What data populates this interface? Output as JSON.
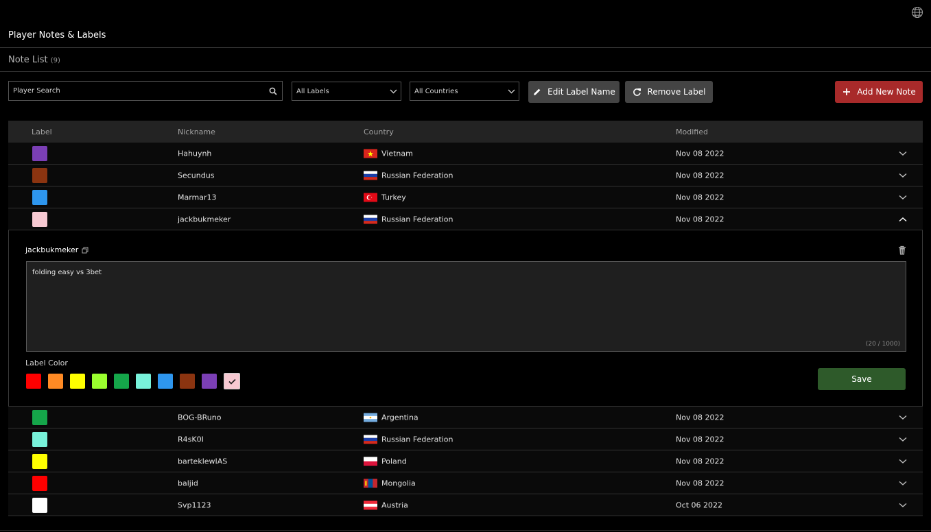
{
  "header": {
    "title": "Player Notes & Labels",
    "note_list_label": "Note List",
    "note_count": "(9)",
    "language_icon": "globe-icon"
  },
  "toolbar": {
    "search_placeholder": "Player Search",
    "labels_filter": "All Labels",
    "countries_filter": "All Countries",
    "edit_label_name": "Edit Label Name",
    "remove_label": "Remove Label",
    "add_new_note": "Add New Note"
  },
  "table": {
    "headers": {
      "label": "Label",
      "nickname": "Nickname",
      "country": "Country",
      "modified": "Modified"
    },
    "rows": [
      {
        "label_color": "#7b3fb5",
        "nickname": "Hahuynh",
        "country": "Vietnam",
        "flag": "vn",
        "modified": "Nov 08 2022",
        "expanded": false
      },
      {
        "label_color": "#8b3410",
        "nickname": "Secundus",
        "country": "Russian Federation",
        "flag": "ru",
        "modified": "Nov 08 2022",
        "expanded": false
      },
      {
        "label_color": "#2e96ee",
        "nickname": "Marmar13",
        "country": "Turkey",
        "flag": "tr",
        "modified": "Nov 08 2022",
        "expanded": false
      },
      {
        "label_color": "#f7c9d2",
        "nickname": "jackbukmeker",
        "country": "Russian Federation",
        "flag": "ru",
        "modified": "Nov 08 2022",
        "expanded": true
      },
      {
        "label_color": "#15a64a",
        "nickname": "BOG-BRuno",
        "country": "Argentina",
        "flag": "ar",
        "modified": "Nov 08 2022",
        "expanded": false
      },
      {
        "label_color": "#78f2da",
        "nickname": "R4sK0I",
        "country": "Russian Federation",
        "flag": "ru",
        "modified": "Nov 08 2022",
        "expanded": false
      },
      {
        "label_color": "#ffff00",
        "nickname": "barteklewIAS",
        "country": "Poland",
        "flag": "pl",
        "modified": "Nov 08 2022",
        "expanded": false
      },
      {
        "label_color": "#ff0000",
        "nickname": "baljid",
        "country": "Mongolia",
        "flag": "mn",
        "modified": "Nov 08 2022",
        "expanded": false
      },
      {
        "label_color": "#ffffff",
        "nickname": "Svp1123",
        "country": "Austria",
        "flag": "at",
        "modified": "Oct 06 2022",
        "expanded": false
      }
    ]
  },
  "expanded_note": {
    "player": "jackbukmeker",
    "text": "folding easy vs 3bet",
    "counter": "(20 / 1000)",
    "label_color_title": "Label Color",
    "palette": [
      "#ff0000",
      "#ff8a24",
      "#ffff00",
      "#9aff2e",
      "#15a64a",
      "#78f2da",
      "#2e96ee",
      "#8b3410",
      "#7b3fb5",
      "#f7c9d2"
    ],
    "selected_color": "#f7c9d2",
    "save_label": "Save"
  }
}
